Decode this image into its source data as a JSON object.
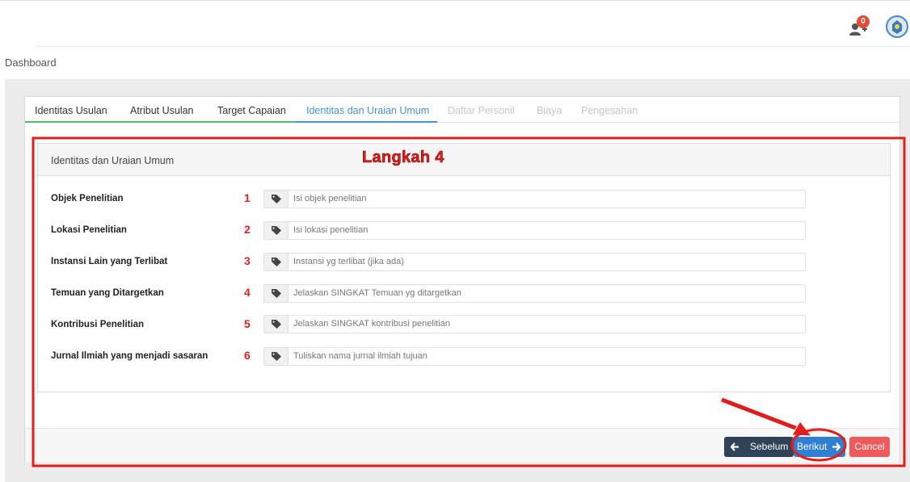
{
  "header": {
    "notification_count": "0",
    "icons": {
      "user": "user-plus-icon",
      "avatar": "university-logo-icon"
    }
  },
  "breadcrumb": "Dashboard",
  "tabs": [
    {
      "label": "Identitas Usulan",
      "state": "normal"
    },
    {
      "label": "Atribut Usulan",
      "state": "normal"
    },
    {
      "label": "Target Capaian",
      "state": "normal"
    },
    {
      "label": "Identitas dan Uraian Umum",
      "state": "active"
    },
    {
      "label": "Daftar Personil",
      "state": "disabled"
    },
    {
      "label": "Biaya",
      "state": "disabled"
    },
    {
      "label": "Pengesahan",
      "state": "disabled"
    }
  ],
  "panel": {
    "title": "Identitas dan Uraian Umum",
    "fields": [
      {
        "num": "1",
        "label": "Objek Penelitian",
        "placeholder": "Isi objek penelitian",
        "value": ""
      },
      {
        "num": "2",
        "label": "Lokasi Penelitian",
        "placeholder": "Isi lokasi penelitian",
        "value": ""
      },
      {
        "num": "3",
        "label": "Instansi Lain yang Terlibat",
        "placeholder": "Instansi yg terlibat (jika ada)",
        "value": ""
      },
      {
        "num": "4",
        "label": "Temuan yang Ditargetkan",
        "placeholder": "Jelaskan SINGKAT Temuan yg ditargetkan",
        "value": ""
      },
      {
        "num": "5",
        "label": "Kontribusi Penelitian",
        "placeholder": "Jelaskan SINGKAT kontribusi penelitian",
        "value": ""
      },
      {
        "num": "6",
        "label": "Jurnal Ilmiah yang menjadi sasaran",
        "placeholder": "Tuliskan nama jurnal ilmiah tujuan",
        "value": ""
      }
    ]
  },
  "footer": {
    "prev_label": "Sebelum",
    "next_label": "Berikut",
    "cancel_label": "Cancel"
  },
  "annotation": {
    "step_label": "Langkah 4",
    "color": "#e11d1d"
  },
  "colors": {
    "accent": "#4a90d9",
    "tab_underline_green": "#5cb85c",
    "prev_button": "#2e4258",
    "next_button": "#2f7fd3",
    "cancel_button": "#ef5b5b"
  }
}
